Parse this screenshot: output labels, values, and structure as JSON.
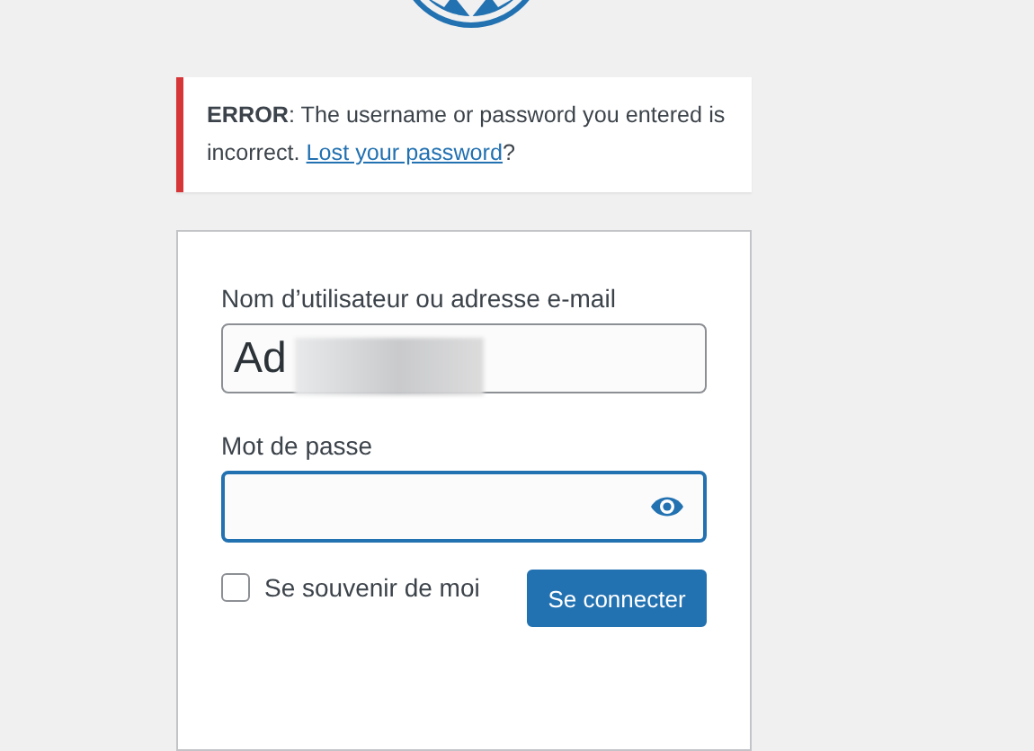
{
  "error": {
    "message": "**ERROR**: The username or password you entered is incorrect. ",
    "link": "Lost your password",
    "after": "?"
  },
  "form": {
    "username_label": "Nom d’utilisateur ou adresse e-mail",
    "username_value": "Ad",
    "password_label": "Mot de passe",
    "password_focused": true,
    "remember": {
      "label": "Se souvenir de moi",
      "checked": false
    },
    "submit": "Se connecter"
  }
}
